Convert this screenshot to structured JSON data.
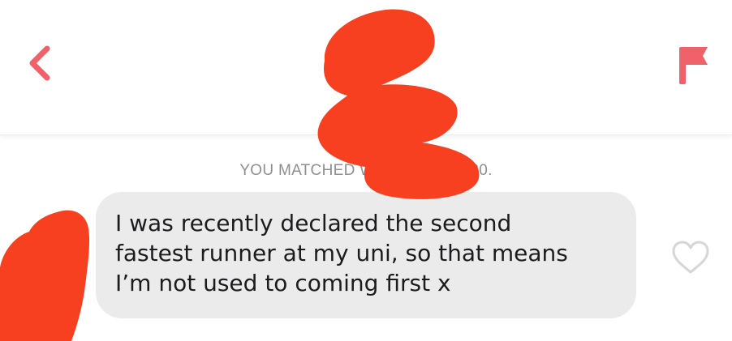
{
  "header": {
    "back_icon": "chevron-left-icon",
    "report_icon": "flag-icon",
    "accent_color": "#f0626a"
  },
  "conversation": {
    "match_notice": "YOU MATCHED WITH J          7/01/2020.",
    "message": {
      "text": "I was recently declared the second\nfastest runner at my uni, so that means\nI’m not used to coming first x",
      "like_icon": "heart-outline-icon"
    }
  },
  "redaction_color": "#f6401f"
}
